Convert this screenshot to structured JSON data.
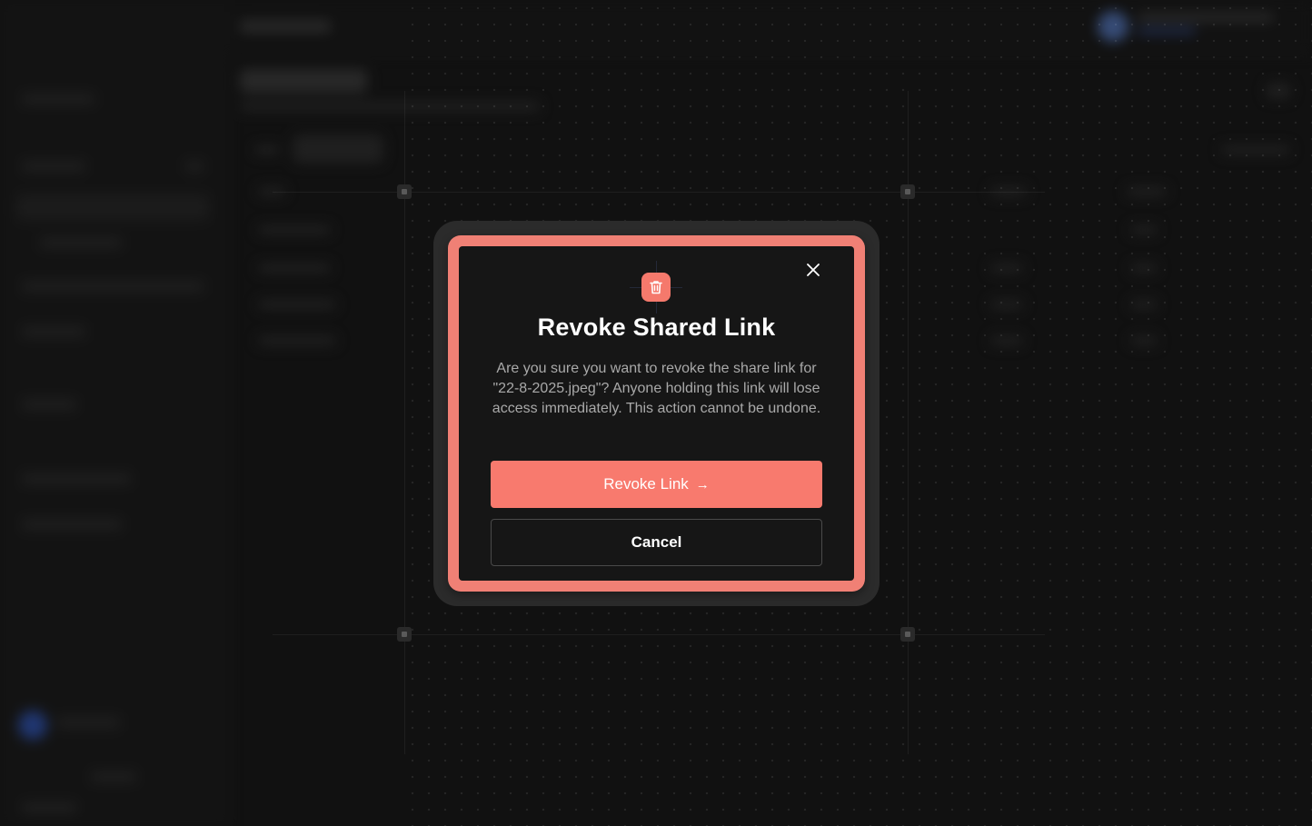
{
  "modal": {
    "title": "Revoke Shared Link",
    "description": "Are you sure you want to revoke the share link for \"22-8-2025.jpeg\"? Anyone holding this link will lose access immediately. This action cannot be undone.",
    "primary_label": "Revoke Link",
    "primary_arrow": "→",
    "secondary_label": "Cancel",
    "icons": {
      "header": "trash-icon",
      "close": "close-icon",
      "arrow": "arrow-right-icon"
    }
  },
  "colors": {
    "accent": "#f87a6e",
    "frame": "#f08075",
    "modal_bg": "#161616",
    "page_bg": "#161616"
  }
}
